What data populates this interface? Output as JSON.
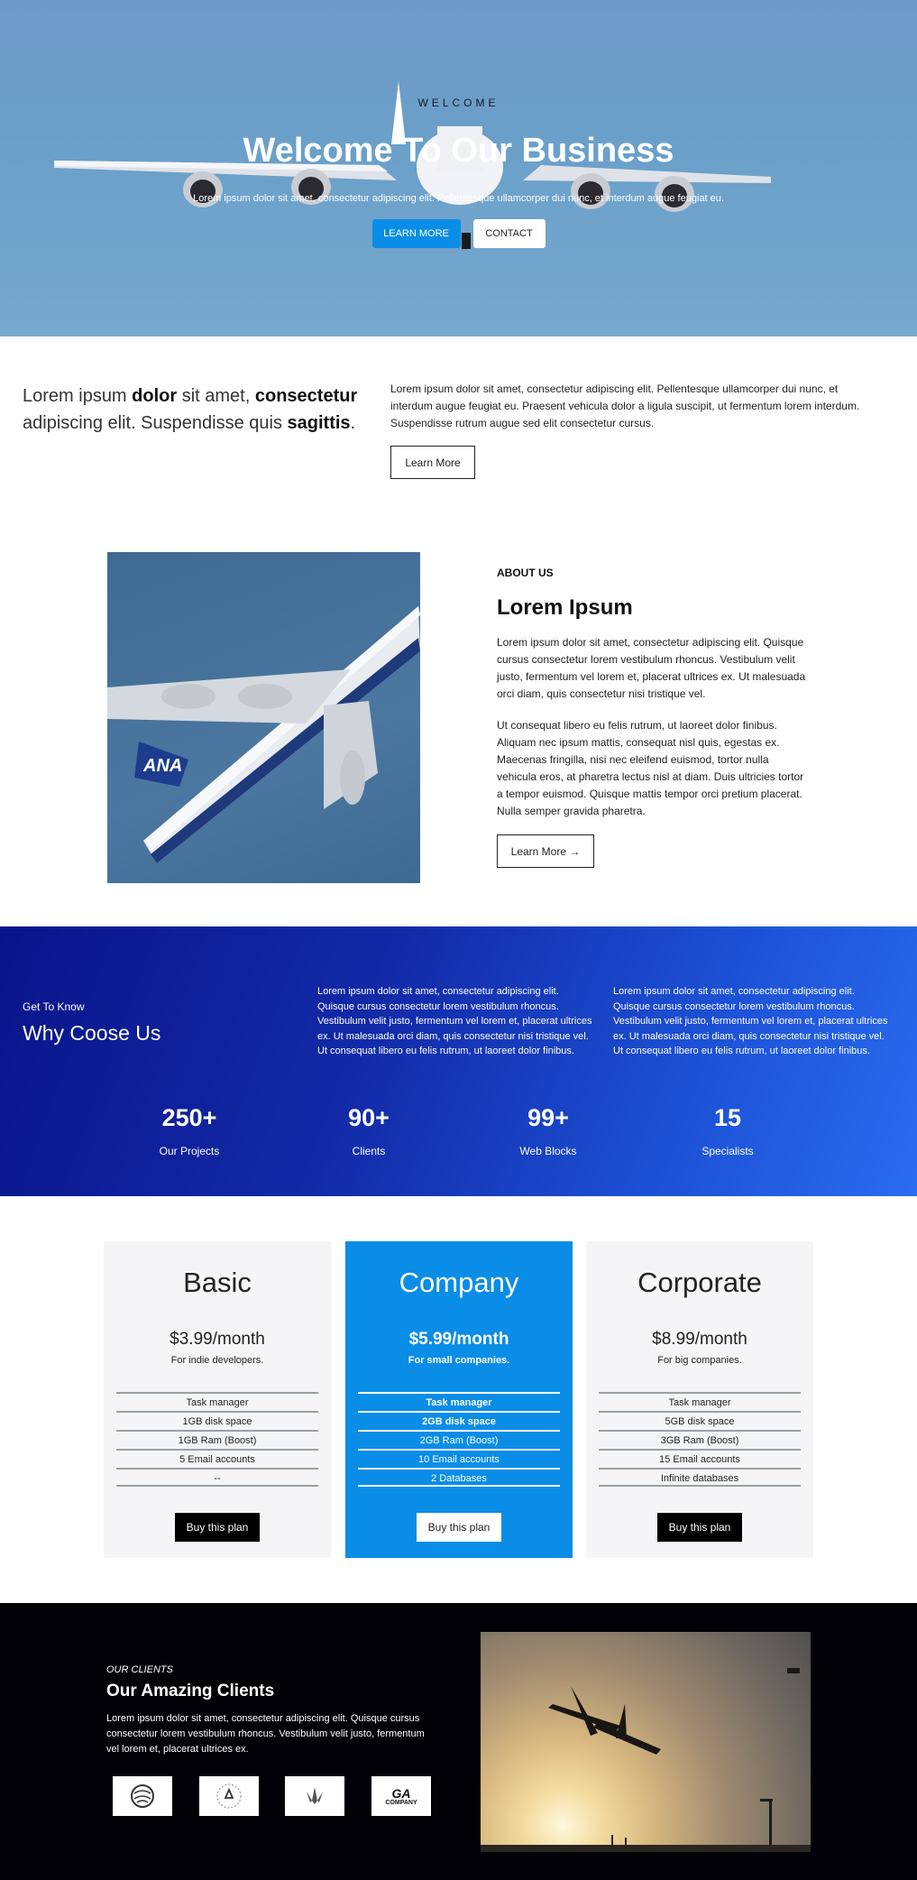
{
  "hero": {
    "welcome": "WELCOME",
    "title": "Welcome To Our Business",
    "subtitle": "Lorem ipsum dolor sit amet, consectetur adipiscing elit. Pellentesque ullamcorper dui nunc, et interdum augue feugiat eu.",
    "learn_more": "LEARN MORE",
    "contact": "CONTACT"
  },
  "intro": {
    "lead_1": "Lorem ipsum ",
    "lead_2": "dolor",
    "lead_3": " sit amet, ",
    "lead_4": "consectetur",
    "lead_5": " adipiscing elit. Suspendisse quis ",
    "lead_6": "sagittis",
    "lead_7": ".",
    "text": "Lorem ipsum dolor sit amet, consectetur adipiscing elit. Pellentesque ullamcorper dui nunc, et interdum augue feugiat eu. Praesent vehicula dolor a ligula suscipit, ut fermentum lorem interdum. Suspendisse rutrum augue sed elit consectetur cursus.",
    "button": "Learn More"
  },
  "about": {
    "label": "ABOUT US",
    "title": "Lorem Ipsum",
    "p1": "Lorem ipsum dolor sit amet, consectetur adipiscing elit. Quisque cursus consectetur lorem vestibulum rhoncus. Vestibulum velit justo, fermentum vel lorem et, placerat ultrices ex. Ut malesuada orci diam, quis consectetur nisi tristique vel.",
    "p2": "Ut consequat libero eu felis rutrum, ut laoreet dolor finibus. Aliquam nec ipsum mattis, consequat nisl quis, egestas ex. Maecenas fringilla, nisi nec eleifend euismod, tortor nulla vehicula eros, at pharetra lectus nisl at diam. Duis ultricies tortor a tempor euismod. Quisque mattis tempor orci pretium placerat. Nulla semper gravida pharetra.",
    "button": "Learn More →",
    "image_tail": "ANA"
  },
  "why": {
    "small": "Get To Know",
    "title": "Why Coose Us",
    "p1": "Lorem ipsum dolor sit amet, consectetur adipiscing elit. Quisque cursus consectetur lorem vestibulum rhoncus. Vestibulum velit justo, fermentum vel lorem et, placerat ultrices ex. Ut malesuada orci diam, quis consectetur nisi tristique vel. Ut consequat libero eu felis rutrum, ut laoreet dolor finibus.",
    "p2": "Lorem ipsum dolor sit amet, consectetur adipiscing elit. Quisque cursus consectetur lorem vestibulum rhoncus. Vestibulum velit justo, fermentum vel lorem et, placerat ultrices ex. Ut malesuada orci diam, quis consectetur nisi tristique vel. Ut consequat libero eu felis rutrum, ut laoreet dolor finibus.",
    "stats": [
      {
        "num": "250+",
        "label": "Our Projects"
      },
      {
        "num": "90+",
        "label": "Clients"
      },
      {
        "num": "99+",
        "label": "Web Blocks"
      },
      {
        "num": "15",
        "label": "Specialists"
      }
    ]
  },
  "pricing": [
    {
      "name": "Basic",
      "price": "$3.99/month",
      "desc": "For indie developers.",
      "features": [
        "Task manager",
        "1GB disk space",
        "1GB Ram (Boost)",
        "5 Email accounts",
        "--"
      ],
      "button": "Buy this plan"
    },
    {
      "name": "Company",
      "price": "$5.99/month",
      "desc": "For small companies.",
      "features": [
        "Task manager",
        "2GB disk space",
        "2GB Ram (Boost)",
        "10 Email accounts",
        "2 Databases"
      ],
      "button": "Buy this plan"
    },
    {
      "name": "Corporate",
      "price": "$8.99/month",
      "desc": "For big companies.",
      "features": [
        "Task manager",
        "5GB disk space",
        "3GB Ram (Boost)",
        "15 Email accounts",
        "Infinite databases"
      ],
      "button": "Buy this plan"
    }
  ],
  "clients": {
    "small": "OUR CLIENTS",
    "title": "Our Amazing Clients",
    "text": "Lorem ipsum dolor sit amet, consectetur adipiscing elit. Quisque cursus consectetur lorem vestibulum rhoncus. Vestibulum velit justo, fermentum vel lorem et, placerat ultrices ex.",
    "logo_text_top": "GA",
    "logo_text_bottom": "COMPANY"
  },
  "colors": {
    "accent_blue": "#0a8de6",
    "why_gradient_start": "#0a148a",
    "why_gradient_end": "#2a6cf0",
    "clients_bg": "#020106"
  }
}
